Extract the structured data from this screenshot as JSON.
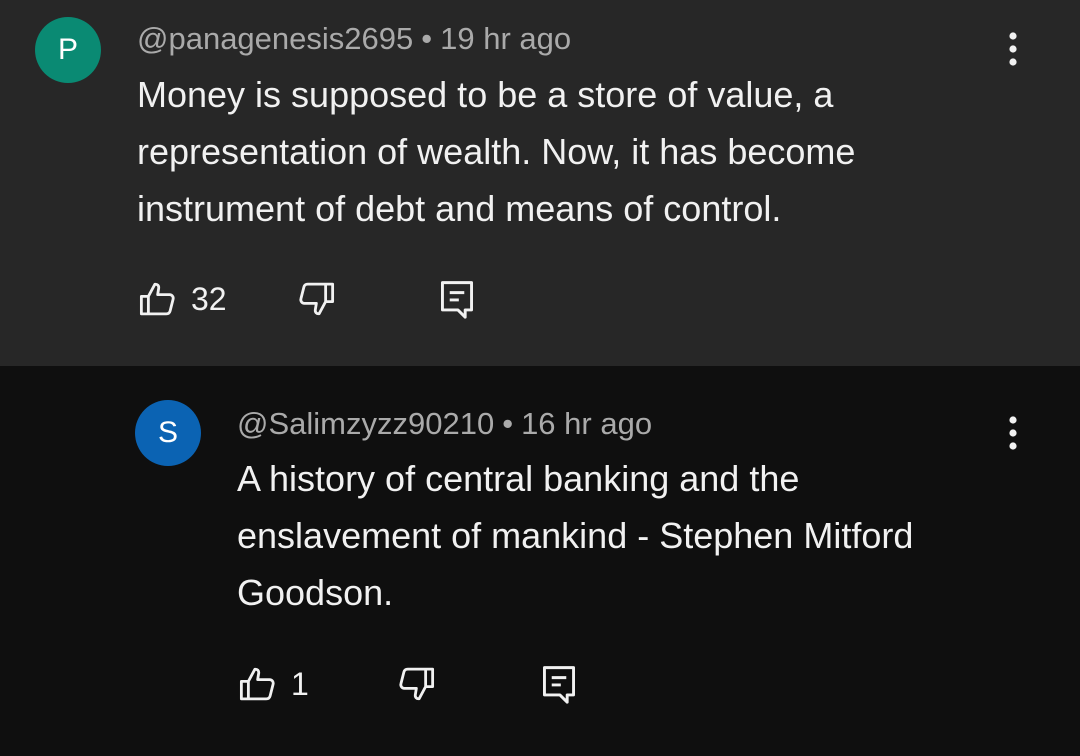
{
  "comments": [
    {
      "avatar_letter": "P",
      "avatar_color": "#0a8a73",
      "author": "@panagenesis2695",
      "separator": "•",
      "time": "19 hr ago",
      "text_lines": [
        "Money is supposed to be a store of value, a",
        "representation of wealth. Now, it has become",
        "instrument of debt and means of control."
      ],
      "like_count": "32",
      "icons": {
        "like": "thumb-up-icon",
        "dislike": "thumb-down-icon",
        "reply": "reply-icon",
        "menu": "more-vert-icon"
      }
    },
    {
      "avatar_letter": "S",
      "avatar_color": "#0b63b3",
      "author": "@Salimzyzz90210",
      "separator": "•",
      "time": "16 hr ago",
      "text_lines": [
        "A history of central banking and the",
        "enslavement of mankind - Stephen Mitford",
        "Goodson."
      ],
      "like_count": "1",
      "icons": {
        "like": "thumb-up-icon",
        "dislike": "thumb-down-icon",
        "reply": "reply-icon",
        "menu": "more-vert-icon"
      }
    }
  ],
  "colors": {
    "top_background": "#272727",
    "reply_background": "#0f0f0f",
    "meta_text": "#aaaaaa",
    "body_text": "#f1f1f1"
  }
}
